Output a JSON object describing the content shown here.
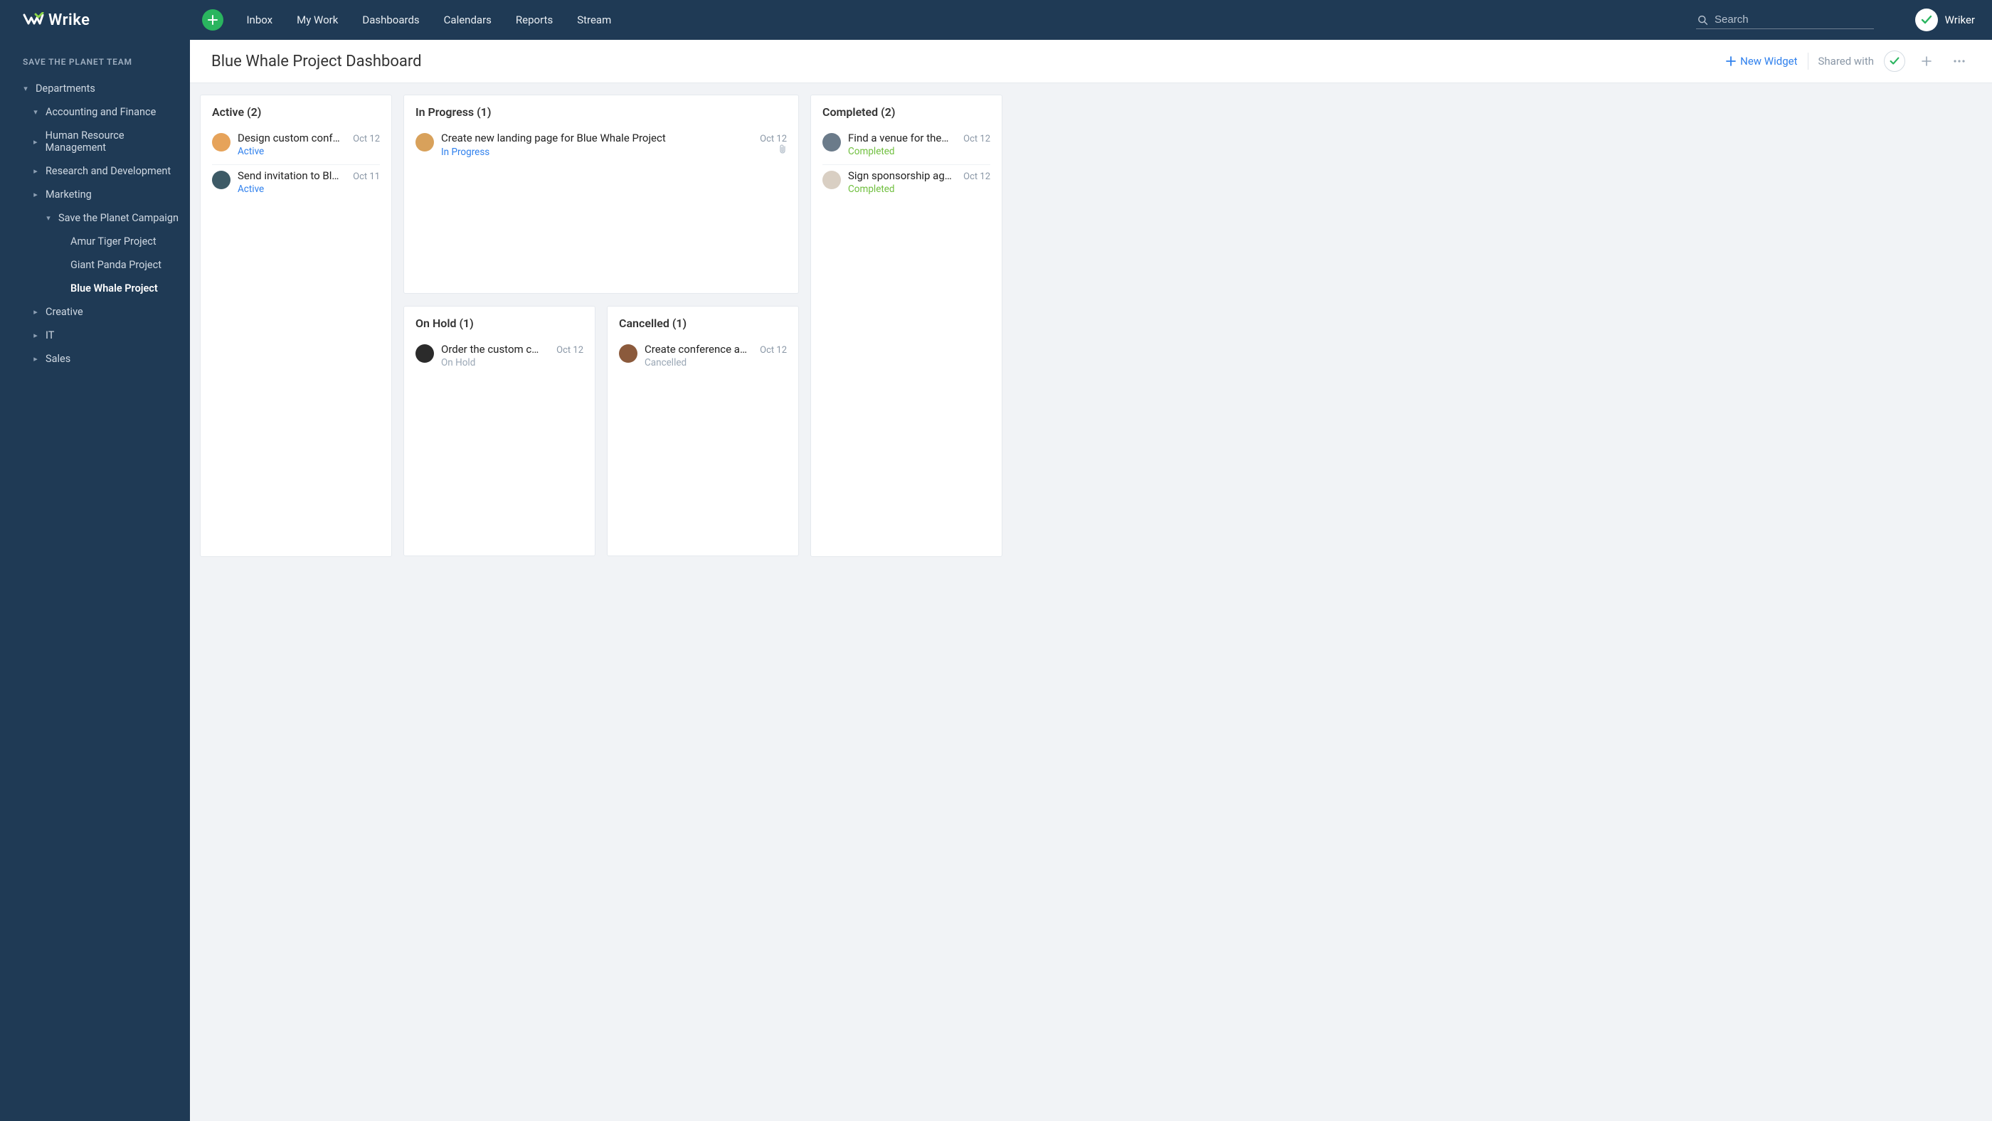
{
  "app": {
    "name": "Wrike"
  },
  "nav": {
    "items": [
      "Inbox",
      "My Work",
      "Dashboards",
      "Calendars",
      "Reports",
      "Stream"
    ]
  },
  "search": {
    "placeholder": "Search"
  },
  "user": {
    "name": "Wriker"
  },
  "sidebar": {
    "team": "SAVE THE PLANET TEAM",
    "root": {
      "label": "Departments",
      "expanded": true
    },
    "departments": [
      {
        "label": "Accounting and Finance",
        "expanded": true,
        "children": []
      },
      {
        "label": "Human Resource Management",
        "expanded": false
      },
      {
        "label": "Research and Development",
        "expanded": false
      },
      {
        "label": "Marketing",
        "expanded": false,
        "subExpanded": true,
        "campaign": {
          "label": "Save the Planet Campaign",
          "expanded": true,
          "projects": [
            {
              "label": "Amur Tiger Project",
              "active": false
            },
            {
              "label": "Giant Panda Project",
              "active": false
            },
            {
              "label": "Blue Whale Project",
              "active": true
            }
          ]
        }
      },
      {
        "label": "Creative",
        "expanded": false
      },
      {
        "label": "IT",
        "expanded": false
      },
      {
        "label": "Sales",
        "expanded": false
      }
    ]
  },
  "header": {
    "title": "Blue Whale Project Dashboard",
    "newWidget": "New Widget",
    "sharedWith": "Shared with"
  },
  "widgets": {
    "active": {
      "title": "Active (2)",
      "tasks": [
        {
          "title": "Design custom conf…",
          "date": "Oct 12",
          "status": "Active",
          "statusClass": "st-active",
          "avatar": "#e6a35a"
        },
        {
          "title": "Send invitation to Bl…",
          "date": "Oct 11",
          "status": "Active",
          "statusClass": "st-active",
          "avatar": "#3d5a66"
        }
      ]
    },
    "inprogress": {
      "title": "In Progress (1)",
      "tasks": [
        {
          "title": "Create new landing page for Blue Whale Project",
          "date": "Oct 12",
          "status": "In Progress",
          "statusClass": "st-inprogress",
          "avatar": "#d8a15b",
          "hasAttachment": true
        }
      ]
    },
    "completed": {
      "title": "Completed (2)",
      "tasks": [
        {
          "title": "Find a venue for the…",
          "date": "Oct 12",
          "status": "Completed",
          "statusClass": "st-completed",
          "avatar": "#6b7b8a"
        },
        {
          "title": "Sign sponsorship ag…",
          "date": "Oct 12",
          "status": "Completed",
          "statusClass": "st-completed",
          "avatar": "#d9cfc3"
        }
      ]
    },
    "onhold": {
      "title": "On Hold (1)",
      "tasks": [
        {
          "title": "Order the custom c…",
          "date": "Oct 12",
          "status": "On Hold",
          "statusClass": "st-onhold",
          "avatar": "#2b2b2b"
        }
      ]
    },
    "cancelled": {
      "title": "Cancelled (1)",
      "tasks": [
        {
          "title": "Create conference a…",
          "date": "Oct 12",
          "status": "Cancelled",
          "statusClass": "st-cancelled",
          "avatar": "#8b5a3c"
        }
      ]
    }
  }
}
